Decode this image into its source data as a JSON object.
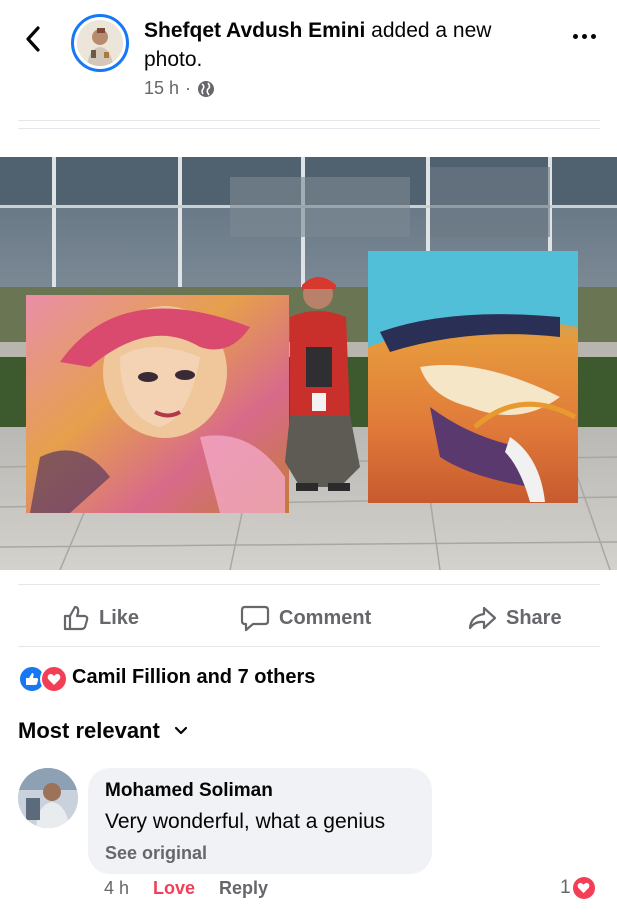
{
  "post": {
    "author": "Shefqet Avdush Emini",
    "action": "added a new photo.",
    "time": "15 h",
    "separator": "·",
    "audience_icon": "globe-icon"
  },
  "actions": {
    "like": "Like",
    "comment": "Comment",
    "share": "Share"
  },
  "reactions": {
    "text": "Camil Fillion and 7 others",
    "icons": [
      "like-icon",
      "love-icon"
    ]
  },
  "sort": {
    "label": "Most relevant"
  },
  "comment": {
    "author": "Mohamed Soliman",
    "text": "Very wonderful, what a genius",
    "see_original": "See original",
    "time": "4 h",
    "reaction_label": "Love",
    "reply_label": "Reply",
    "reaction_count": "1"
  },
  "colors": {
    "accent": "#1877f2",
    "love": "#f33e58",
    "muted_text": "#65676b",
    "bubble": "#f0f2f5"
  }
}
